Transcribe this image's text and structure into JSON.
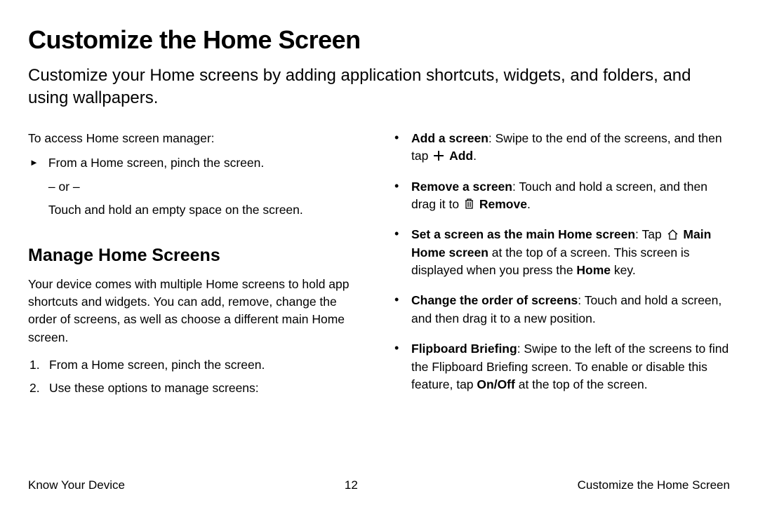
{
  "title": "Customize the Home Screen",
  "intro": "Customize your Home screens by adding application shortcuts, widgets, and folders, and using wallpapers.",
  "left": {
    "accessLabel": "To access Home screen manager:",
    "pinch": "From a Home screen, pinch the screen.",
    "or": "– or –",
    "touchHold": "Touch and hold an empty space on the screen.",
    "manageHeading": "Manage Home Screens",
    "managePara": "Your device comes with multiple Home screens to hold app shortcuts and widgets. You can add, remove, change the order of screens, as well as choose a different main Home screen.",
    "step1": "From a Home screen, pinch the screen.",
    "step2": "Use these options to manage screens:"
  },
  "right": {
    "addTitle": "Add a screen",
    "addText1": ": Swipe to the end of the screens, and then tap ",
    "addBold": "Add",
    "addText2": ".",
    "removeTitle": "Remove a screen",
    "removeText1": ": Touch and hold a screen, and then drag it to ",
    "removeBold": "Remove",
    "removeText2": ".",
    "mainTitle": "Set a screen as the main Home screen",
    "mainText1": ": Tap ",
    "mainBold1": "Main Home screen",
    "mainText2": " at the top of a screen. This screen is displayed when you press the ",
    "mainBold2": "Home",
    "mainText3": " key.",
    "orderTitle": "Change the order of screens",
    "orderText": ": Touch and hold a screen, and then drag it to a new position.",
    "flipTitle": "Flipboard Briefing",
    "flipText1": ": Swipe to the left of the screens to find the Flipboard Briefing screen. To enable or disable this feature, tap ",
    "flipBold": "On/Off",
    "flipText2": " at the top of the screen."
  },
  "footer": {
    "left": "Know Your Device",
    "center": "12",
    "right": "Customize the Home Screen"
  }
}
